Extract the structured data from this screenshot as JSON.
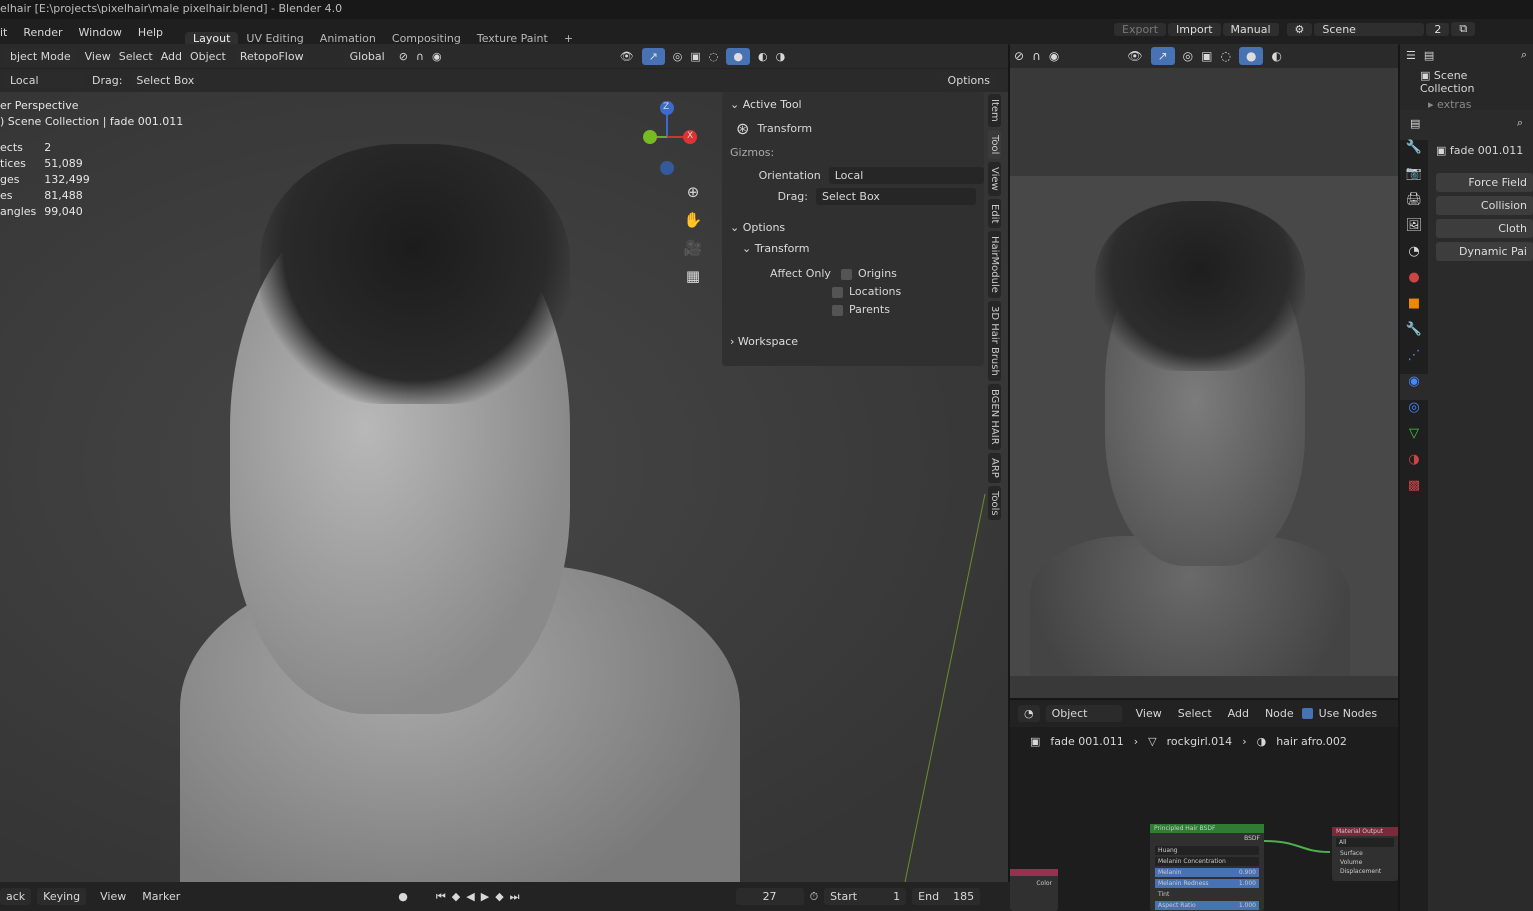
{
  "window_title": "elhair [E:\\projects\\pixelhair\\male pixelhair.blend] - Blender 4.0",
  "menu": [
    "it",
    "Render",
    "Window",
    "Help"
  ],
  "workspaces": [
    {
      "label": "Layout",
      "active": true
    },
    {
      "label": "UV Editing"
    },
    {
      "label": "Animation"
    },
    {
      "label": "Compositing"
    },
    {
      "label": "Texture Paint"
    },
    {
      "label": "+"
    }
  ],
  "top_right": {
    "export": "Export",
    "import": "Import",
    "manual": "Manual",
    "scene": "Scene",
    "users": "2"
  },
  "viewport": {
    "mode": "bject Mode",
    "menus": [
      "View",
      "Select",
      "Add",
      "Object"
    ],
    "addon": "RetopoFlow",
    "orientation": "Global",
    "tool_orientation": "Local",
    "drag_label": "Drag:",
    "drag_value": "Select Box",
    "options": "Options",
    "perspective": "er Perspective",
    "collection": ") Scene Collection | fade 001.011",
    "stats": [
      [
        "ects",
        "2"
      ],
      [
        "tices",
        "51,089"
      ],
      [
        "ges",
        "132,499"
      ],
      [
        "es",
        "81,488"
      ],
      [
        "angles",
        "99,040"
      ]
    ],
    "gizmo": {
      "z": "Z",
      "x": "X"
    }
  },
  "npanel": {
    "active_tool": "Active Tool",
    "tool": "Transform",
    "gizmos": "Gizmos:",
    "orientation_label": "Orientation",
    "orientation": "Local",
    "drag_label": "Drag:",
    "drag": "Select Box",
    "options": "Options",
    "transform": "Transform",
    "affect_only": "Affect Only",
    "checks": [
      "Origins",
      "Locations",
      "Parents"
    ],
    "workspace": "Workspace"
  },
  "side_tabs": [
    "Item",
    "Tool",
    "View",
    "Edit",
    "HairModule",
    "3D Hair Brush",
    "BGEN HAIR",
    "ARP",
    "Tools"
  ],
  "outliner": {
    "root": "Scene Collection",
    "child": "extras"
  },
  "properties": {
    "object": "fade 001.011",
    "buttons": [
      "Force Field",
      "Collision",
      "Cloth",
      "Dynamic Pai"
    ]
  },
  "node_editor": {
    "type": "Object",
    "menus": [
      "View",
      "Select",
      "Add",
      "Node"
    ],
    "use_nodes": "Use Nodes",
    "breadcrumb": [
      "fade 001.011",
      "rockgirl.014",
      "hair afro.002"
    ],
    "hair_node": {
      "title": "Principled Hair BSDF",
      "out": "BSDF",
      "model": "Huang",
      "param": "Melanin Concentration",
      "fields": [
        [
          "Melanin",
          "0.900"
        ],
        [
          "Melanin Redness",
          "1.000"
        ],
        [
          "Tint",
          ""
        ],
        [
          "Aspect Ratio",
          "1.000"
        ]
      ]
    },
    "output_node": {
      "title": "Material Output",
      "target": "All",
      "inputs": [
        "Surface",
        "Volume",
        "Displacement"
      ]
    },
    "left_node_out": "Color"
  },
  "timeline": {
    "menus": [
      "ack",
      "Keying",
      "View",
      "Marker"
    ],
    "frame": "27",
    "start_label": "Start",
    "start": "1",
    "end_label": "End",
    "end": "185"
  },
  "colors": {
    "accent": "#4772b3",
    "node_green": "#2e7d32",
    "node_red": "#7a2a3a"
  }
}
